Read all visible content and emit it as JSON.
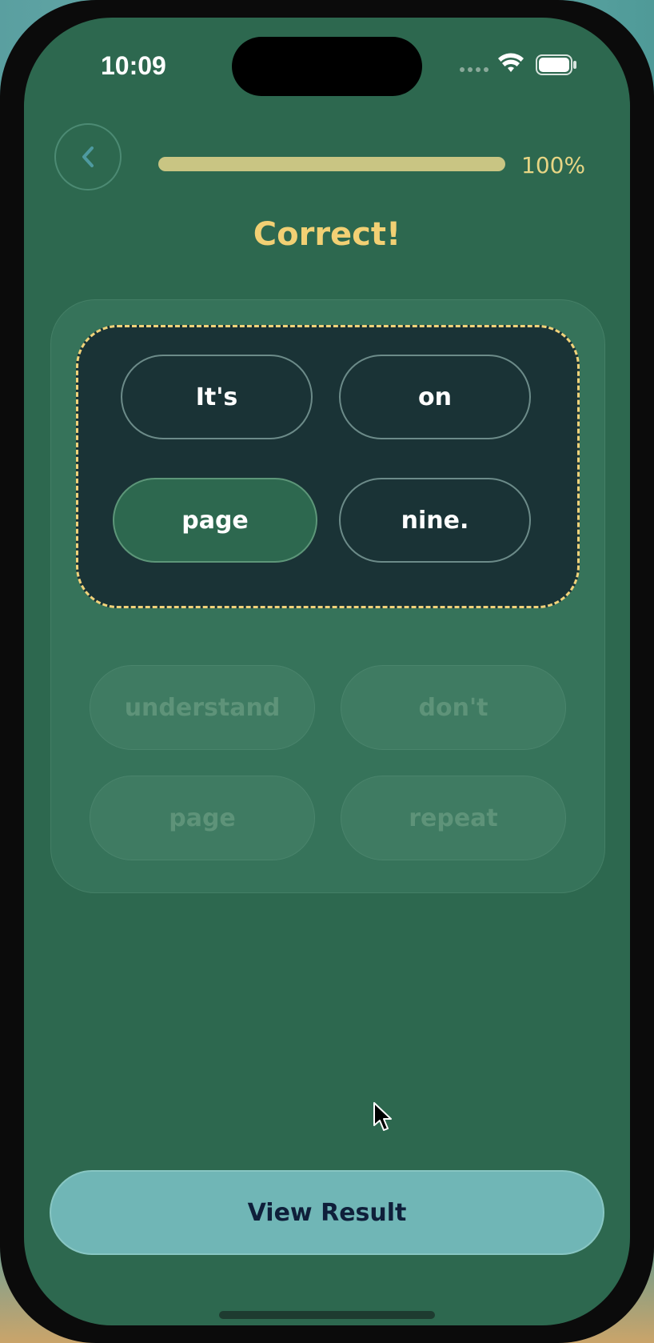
{
  "status_bar": {
    "time": "10:09"
  },
  "header": {
    "back_icon": "chevron-left-icon",
    "progress_value": 1.0,
    "progress_label": "100%"
  },
  "title": "Correct!",
  "answer_zone": {
    "words": [
      "It's",
      "on",
      "page",
      "nine."
    ]
  },
  "word_bank": {
    "words": [
      "understand",
      "don't",
      "page",
      "repeat"
    ]
  },
  "footer": {
    "view_result_label": "View Result"
  },
  "colors": {
    "background": "#2d684f",
    "title": "#f2d074",
    "progress_fill": "#c9c583",
    "answer_zone_bg": "#1a3336",
    "answer_zone_border": "#f1d27a",
    "primary_button": "#70b6b6",
    "primary_button_text": "#0f1f3a"
  }
}
